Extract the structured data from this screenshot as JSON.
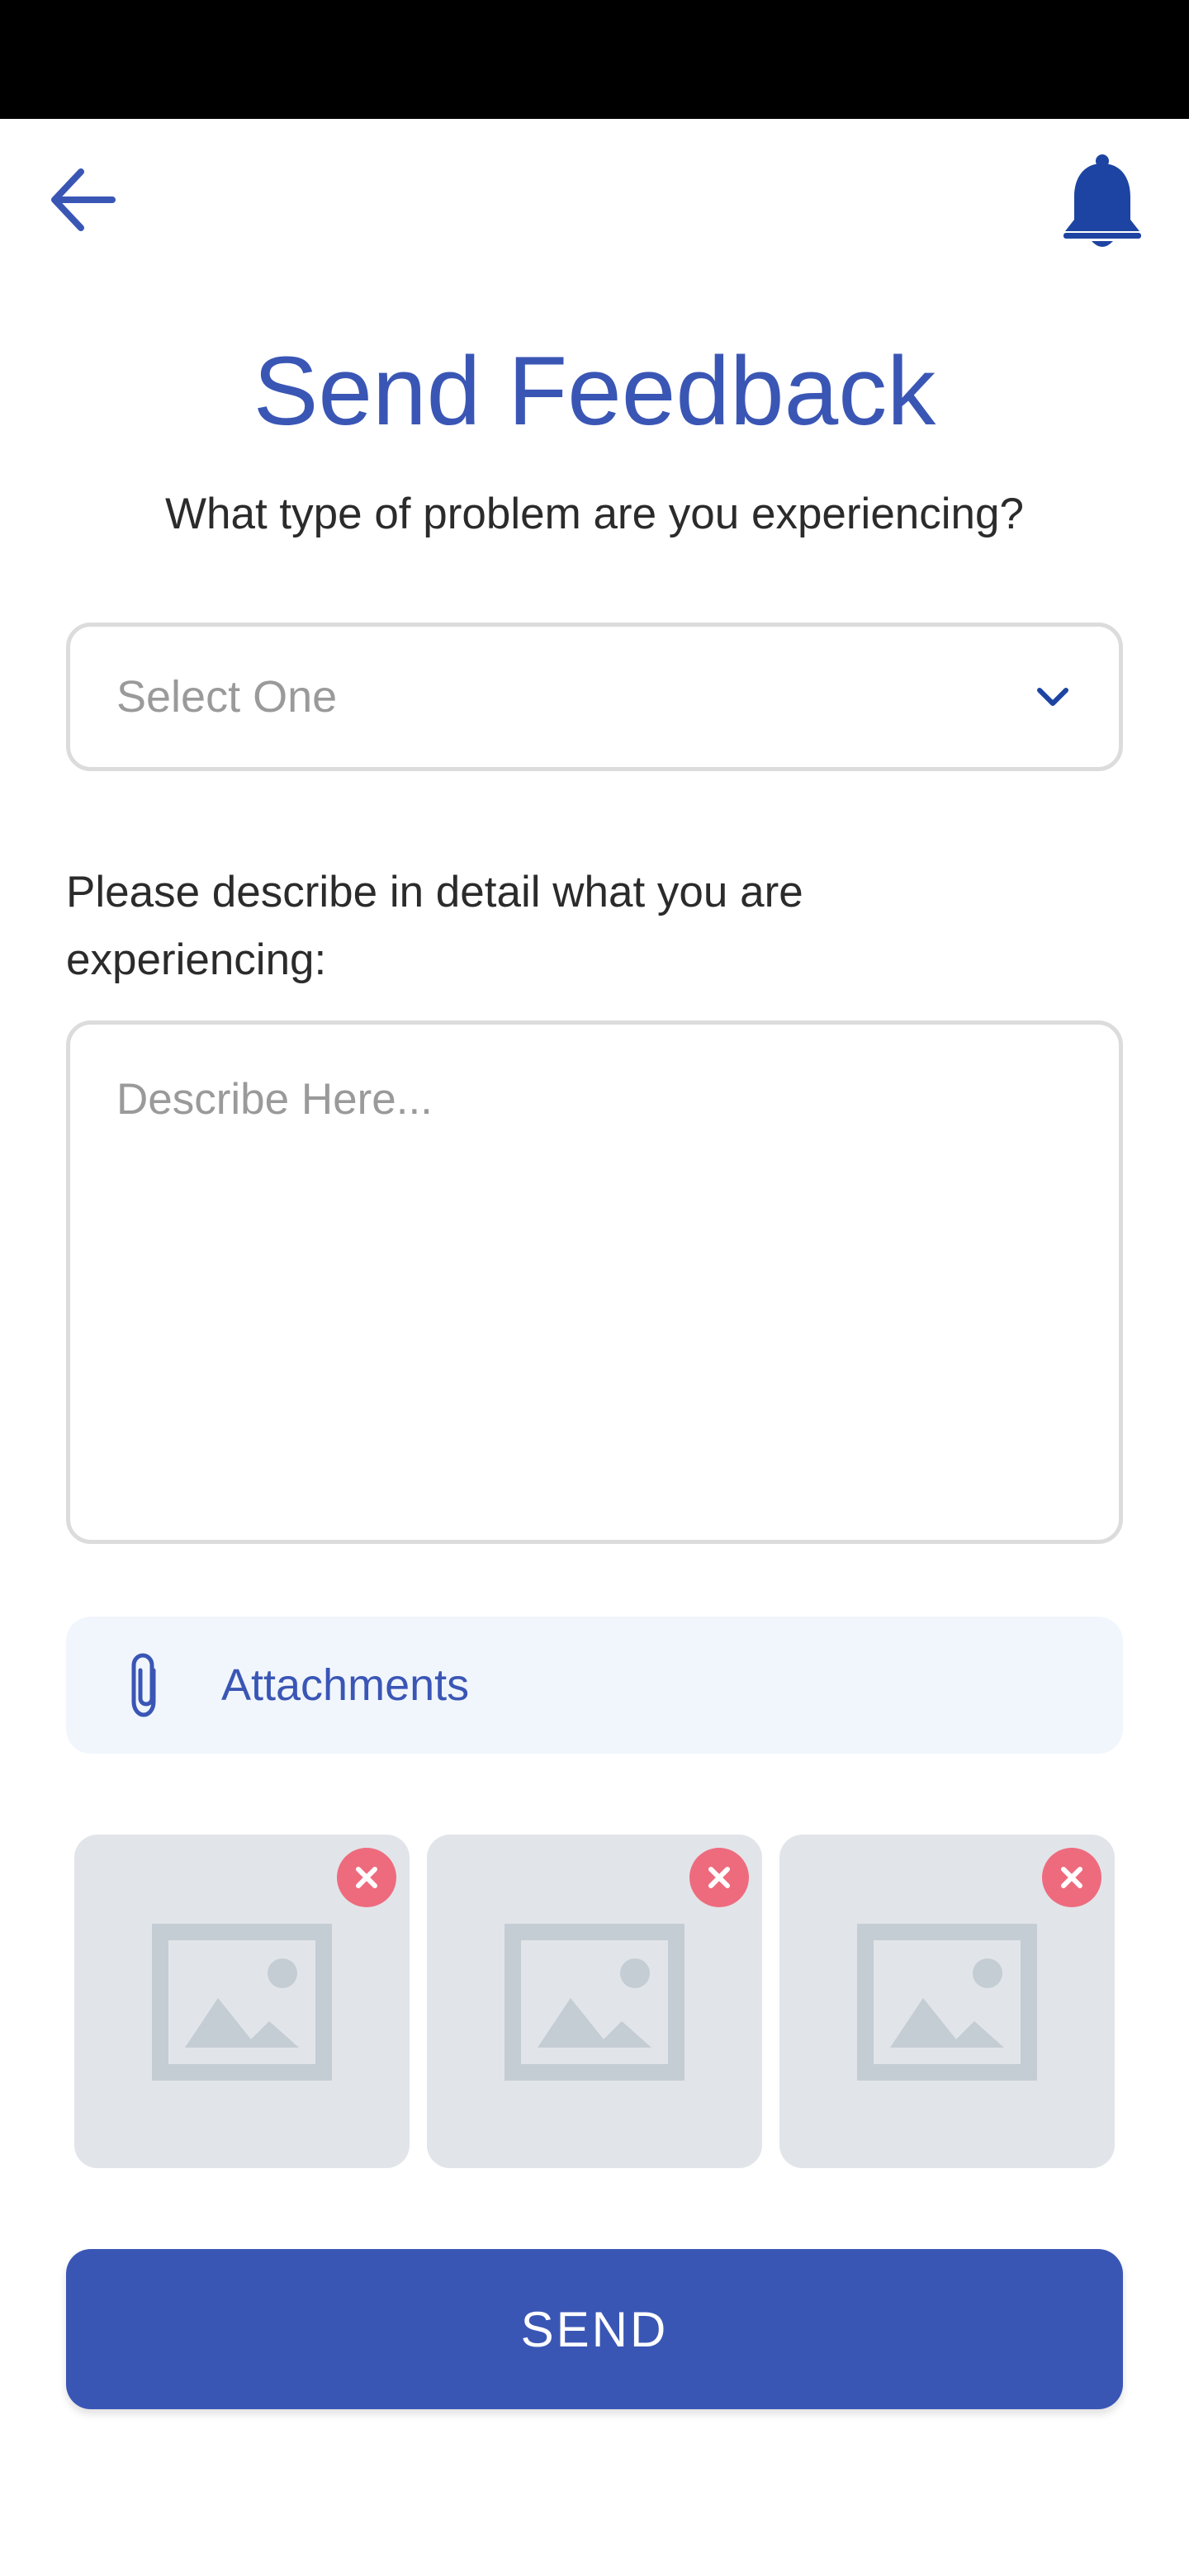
{
  "colors": {
    "accent": "#3a56b5",
    "bell": "#1d44a2",
    "remove_badge": "#ee6b7e",
    "thumb_bg": "#e1e5e9",
    "attach_bg": "#f1f6fd"
  },
  "header": {
    "back_icon": "arrow-left-icon",
    "notification_icon": "bell-icon"
  },
  "title": "Send Feedback",
  "question": "What type of problem are you experiencing?",
  "problem_select": {
    "placeholder": "Select One",
    "icon": "chevron-down-icon"
  },
  "description": {
    "label": "Please describe in detail what you are experiencing:",
    "placeholder": "Describe Here..."
  },
  "attachments": {
    "label": "Attachments",
    "icon": "paperclip-icon",
    "items": [
      {
        "icon": "image-placeholder-icon",
        "remove_icon": "close-icon"
      },
      {
        "icon": "image-placeholder-icon",
        "remove_icon": "close-icon"
      },
      {
        "icon": "image-placeholder-icon",
        "remove_icon": "close-icon"
      }
    ]
  },
  "send_button": "SEND"
}
